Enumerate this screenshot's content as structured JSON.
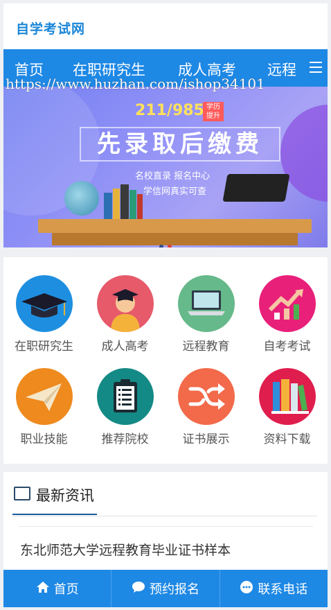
{
  "site": {
    "logo": "自学考试网"
  },
  "nav": {
    "items": [
      "首页",
      "在职研究生",
      "成人高考",
      "远程"
    ],
    "menu_icon": "hamburger-menu-icon"
  },
  "banner": {
    "watermark": "https://www.huzhan.com/ishop34101",
    "badge": "211/985",
    "tag": "学历\n提升",
    "headline": "先录取后缴费",
    "line1": "名校直录  报名中心",
    "line2": "学信网真实可查",
    "dots": 2,
    "active_dot": 1
  },
  "categories": [
    {
      "label": "在职研究生",
      "icon": "graduation-cap-icon",
      "color": "#1e8fe0"
    },
    {
      "label": "成人高考",
      "icon": "student-avatar-icon",
      "color": "#e65a6a"
    },
    {
      "label": "远程教育",
      "icon": "laptop-icon",
      "color": "#66b98a"
    },
    {
      "label": "自考考试",
      "icon": "trending-up-chart-icon",
      "color": "#e8207a"
    },
    {
      "label": "职业技能",
      "icon": "paper-plane-icon",
      "color": "#ee8a1e"
    },
    {
      "label": "推荐院校",
      "icon": "clipboard-list-icon",
      "color": "#148a86"
    },
    {
      "label": "证书展示",
      "icon": "shuffle-icon",
      "color": "#f26a4a"
    },
    {
      "label": "资料下载",
      "icon": "books-icon",
      "color": "#e01e4e"
    }
  ],
  "news": {
    "title": "最新资讯",
    "items": [
      {
        "title": "东北师范大学远程教育毕业证书样本"
      }
    ]
  },
  "footer": {
    "buttons": [
      {
        "label": "首页",
        "icon": "home-icon"
      },
      {
        "label": "预约报名",
        "icon": "chat-bubble-icon"
      },
      {
        "label": "联系电话",
        "icon": "message-dots-icon"
      }
    ]
  },
  "colors": {
    "primary": "#1e88e5",
    "logo": "#1a86d8"
  }
}
